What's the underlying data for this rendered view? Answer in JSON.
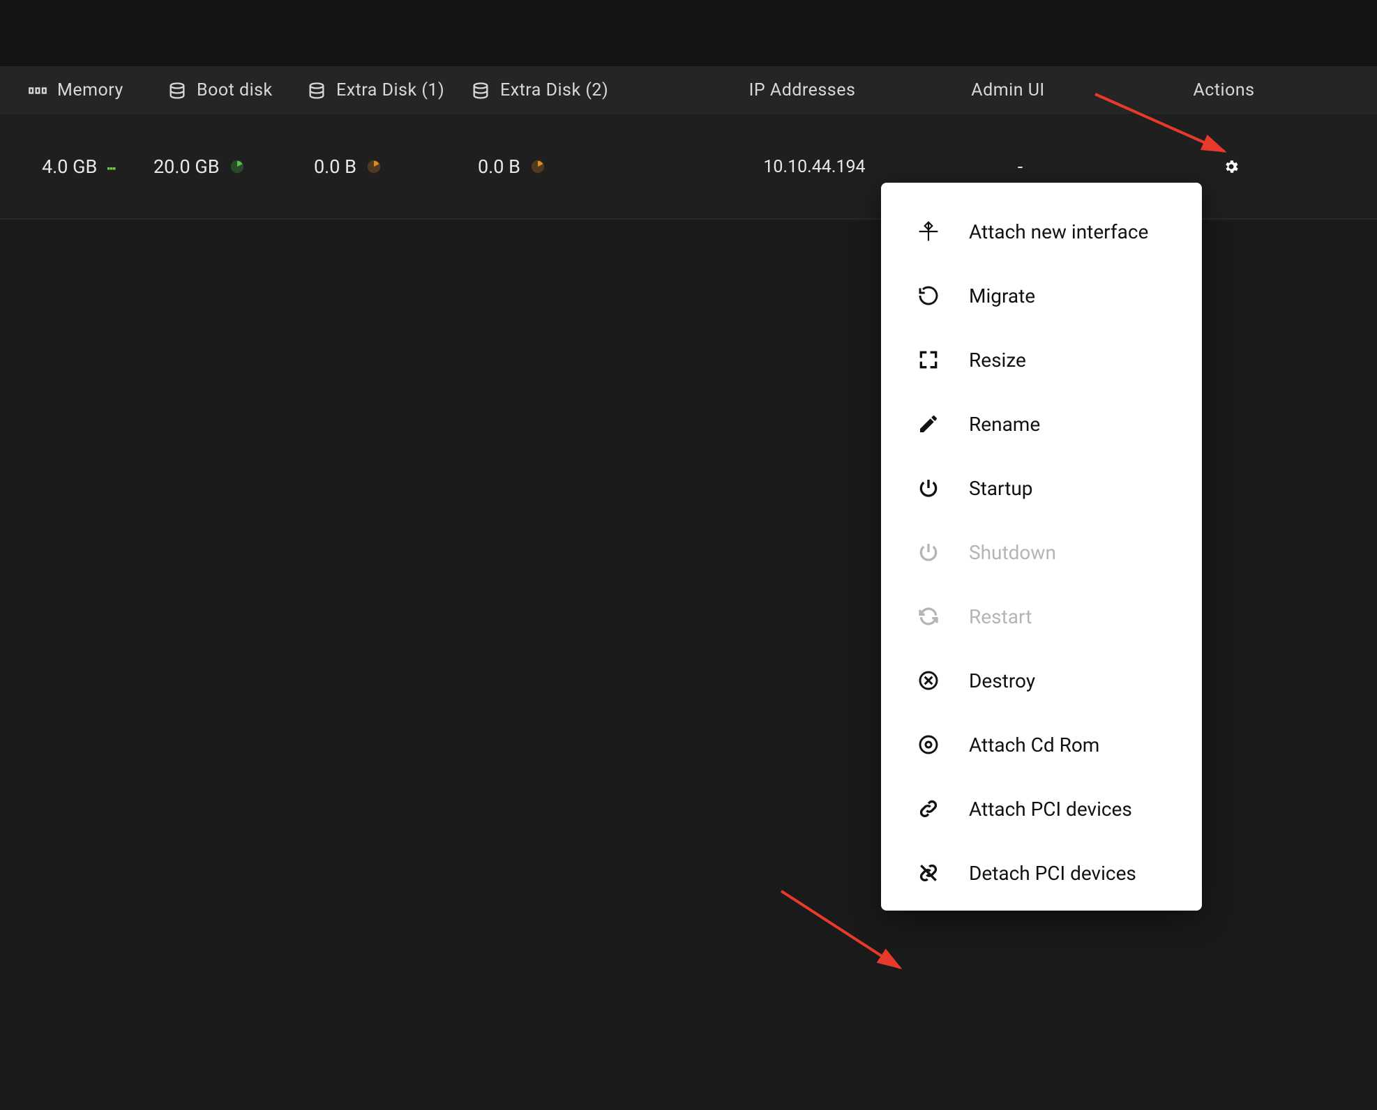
{
  "headers": {
    "memory": "Memory",
    "boot": "Boot disk",
    "extra1": "Extra Disk (1)",
    "extra2": "Extra Disk (2)",
    "ip": "IP Addresses",
    "admin": "Admin UI",
    "actions": "Actions"
  },
  "row": {
    "memory": "4.0 GB",
    "boot": "20.0 GB",
    "extra1": "0.0 B",
    "extra2": "0.0 B",
    "ip": "10.10.44.194",
    "admin": "-"
  },
  "menu": {
    "attach_interface": "Attach new interface",
    "migrate": "Migrate",
    "resize": "Resize",
    "rename": "Rename",
    "startup": "Startup",
    "shutdown": "Shutdown",
    "restart": "Restart",
    "destroy": "Destroy",
    "attach_cdrom": "Attach Cd Rom",
    "attach_pci": "Attach PCI devices",
    "detach_pci": "Detach PCI devices"
  }
}
